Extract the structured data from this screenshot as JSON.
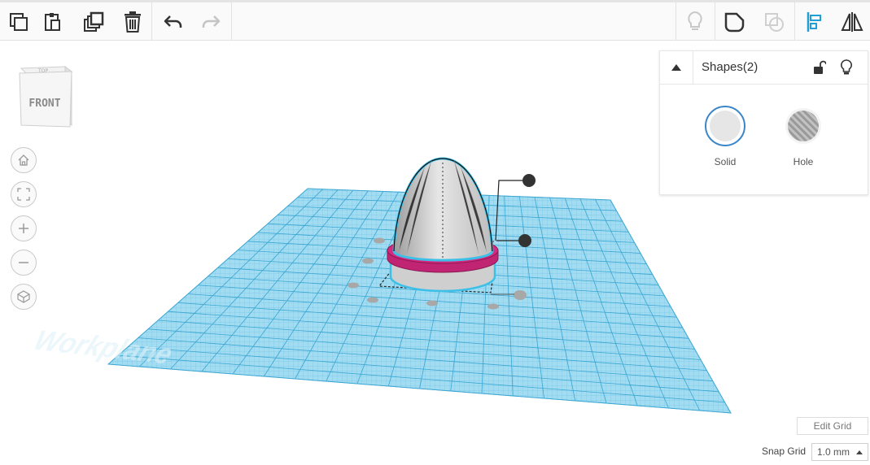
{
  "toolbar": {
    "left_tools": [
      {
        "name": "copy-icon",
        "tooltip": "Copy"
      },
      {
        "name": "paste-icon",
        "tooltip": "Paste"
      },
      {
        "name": "duplicate-icon",
        "tooltip": "Duplicate and repeat"
      },
      {
        "name": "trash-icon",
        "tooltip": "Delete"
      },
      {
        "name": "undo-icon",
        "tooltip": "Undo"
      },
      {
        "name": "redo-icon",
        "tooltip": "Redo"
      }
    ],
    "right_tools": [
      {
        "name": "lightbulb-icon",
        "tooltip": "Show all"
      },
      {
        "name": "group-icon",
        "tooltip": "Group"
      },
      {
        "name": "ungroup-icon",
        "tooltip": "Ungroup"
      },
      {
        "name": "align-icon",
        "tooltip": "Align"
      },
      {
        "name": "mirror-icon",
        "tooltip": "Flip"
      }
    ]
  },
  "viewcube": {
    "top_label": "TOP",
    "front_label": "FRONT"
  },
  "nav": [
    {
      "name": "home-view-icon"
    },
    {
      "name": "fit-all-icon"
    },
    {
      "name": "zoom-in-icon"
    },
    {
      "name": "zoom-out-icon"
    },
    {
      "name": "perspective-icon"
    }
  ],
  "workplane": {
    "watermark": "Workplane",
    "grid_color": "#7fcdea"
  },
  "inspector": {
    "title": "Shapes(2)",
    "solid_label": "Solid",
    "hole_label": "Hole",
    "solid_color": "#e6e6e6"
  },
  "bottom": {
    "edit_grid_label": "Edit Grid",
    "snap_grid_label": "Snap Grid",
    "snap_grid_value": "1.0 mm"
  },
  "colors": {
    "accent": "#1f9fd4",
    "ring": "#d6297f",
    "selection_outline": "#3cc0e8"
  }
}
